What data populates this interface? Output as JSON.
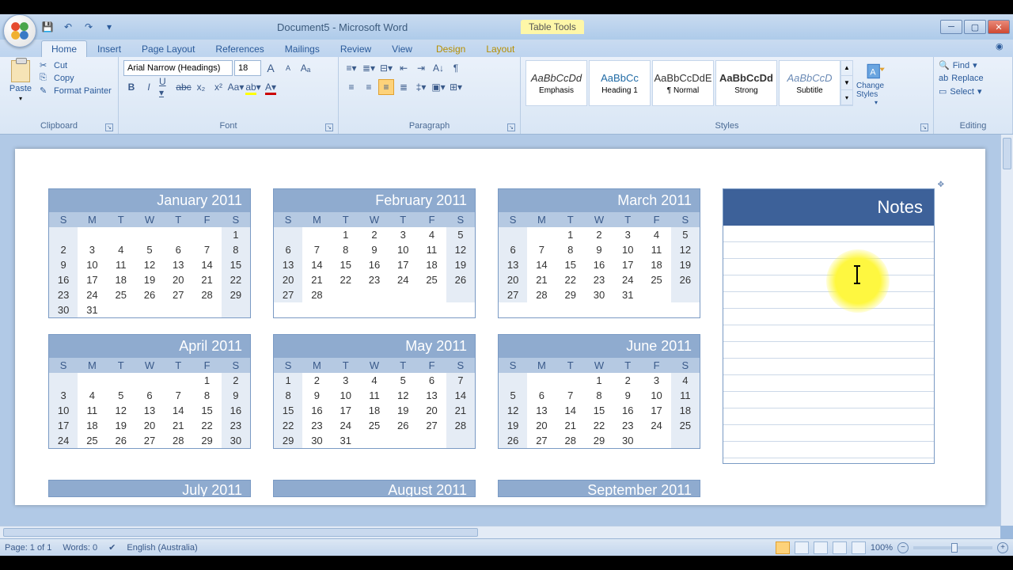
{
  "window": {
    "title": "Document5 - Microsoft Word",
    "context_tab": "Table Tools"
  },
  "tabs": [
    "Home",
    "Insert",
    "Page Layout",
    "References",
    "Mailings",
    "Review",
    "View"
  ],
  "context_tabs": [
    "Design",
    "Layout"
  ],
  "active_tab": "Home",
  "ribbon": {
    "clipboard": {
      "paste": "Paste",
      "cut": "Cut",
      "copy": "Copy",
      "painter": "Format Painter",
      "label": "Clipboard"
    },
    "font": {
      "name": "Arial Narrow (Headings)",
      "size": "18",
      "label": "Font"
    },
    "paragraph": {
      "label": "Paragraph"
    },
    "styles": {
      "label": "Styles",
      "change": "Change Styles",
      "items": [
        {
          "preview": "AaBbCcDd",
          "name": "Emphasis",
          "style": "italic",
          "color": "#333"
        },
        {
          "preview": "AaBbCc",
          "name": "Heading 1",
          "style": "normal",
          "color": "#1f6aa5"
        },
        {
          "preview": "AaBbCcDdE",
          "name": "¶ Normal",
          "style": "normal",
          "color": "#333"
        },
        {
          "preview": "AaBbCcDd",
          "name": "Strong",
          "style": "bold",
          "color": "#333"
        },
        {
          "preview": "AaBbCcD",
          "name": "Subtitle",
          "style": "italic",
          "color": "#6a8ab5"
        }
      ]
    },
    "editing": {
      "find": "Find",
      "replace": "Replace",
      "select": "Select",
      "label": "Editing"
    }
  },
  "calendar": {
    "day_headers": [
      "S",
      "M",
      "T",
      "W",
      "T",
      "F",
      "S"
    ],
    "months": [
      {
        "name": "January 2011",
        "start": 6,
        "days": 31
      },
      {
        "name": "February 2011",
        "start": 2,
        "days": 28
      },
      {
        "name": "March 2011",
        "start": 2,
        "days": 31
      },
      {
        "name": "April 2011",
        "start": 5,
        "days": 30
      },
      {
        "name": "May 2011",
        "start": 0,
        "days": 31
      },
      {
        "name": "June 2011",
        "start": 3,
        "days": 30
      }
    ],
    "partial": [
      "July 2011",
      "August 2011",
      "September 2011"
    ],
    "notes_label": "Notes"
  },
  "status": {
    "page": "Page: 1 of 1",
    "words": "Words: 0",
    "lang": "English (Australia)",
    "zoom": "100%"
  }
}
